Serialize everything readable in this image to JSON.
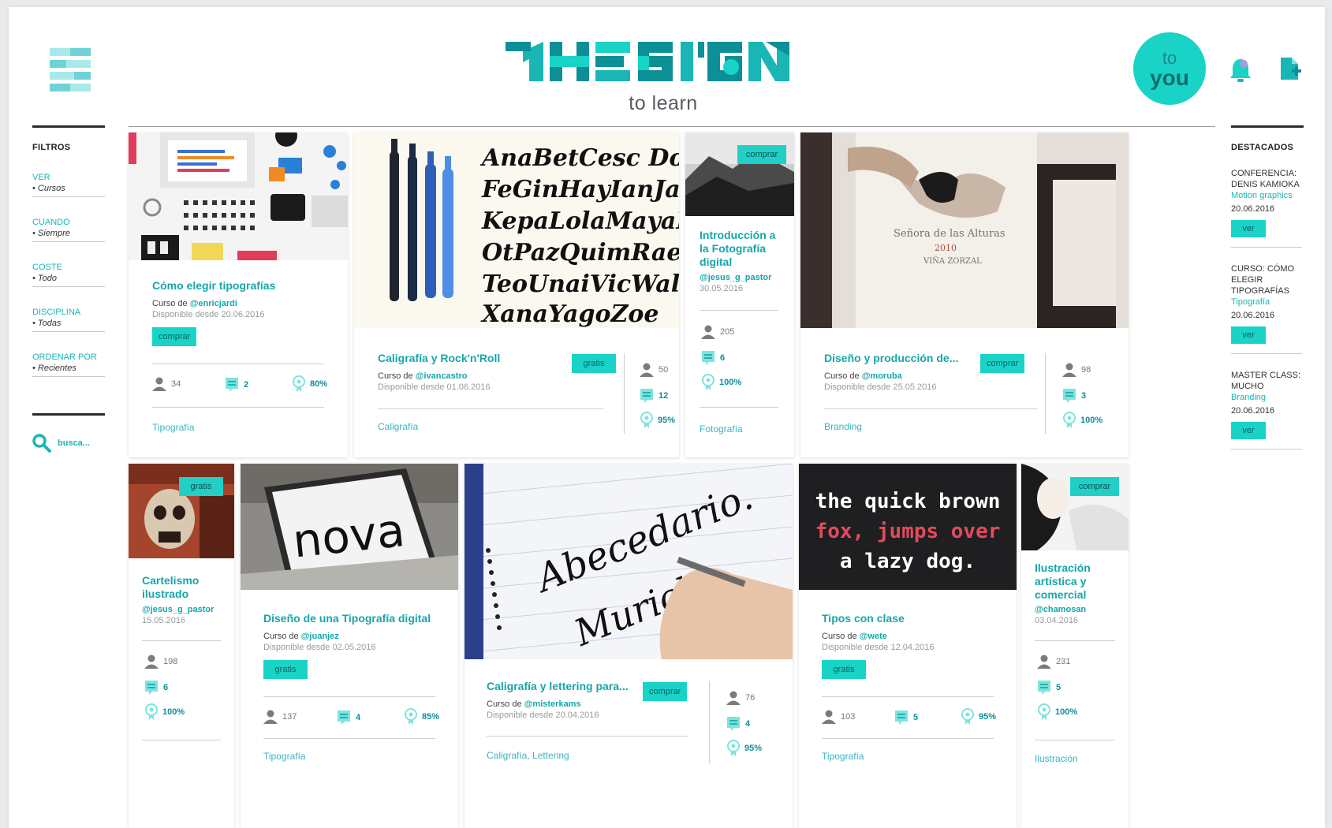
{
  "header": {
    "logo_sub": "to learn",
    "to_you_line1": "to",
    "to_you_line2": "you"
  },
  "sidebar_left": {
    "title": "FILTROS",
    "filters": [
      {
        "key": "VER",
        "value": "• Cursos"
      },
      {
        "key": "CUANDO",
        "value": "• Siempre"
      },
      {
        "key": "COSTE",
        "value": "• Todo"
      },
      {
        "key": "DISCIPLINA",
        "value": "• Todas"
      },
      {
        "key": "ORDENAR POR",
        "value": "• Recientes"
      }
    ],
    "search_label": "busca..."
  },
  "sidebar_right": {
    "title": "DESTACADOS",
    "items": [
      {
        "title": "CONFERENCIA: DENIS KAMIOKA",
        "category": "Motion graphics",
        "date": "20.06.2016",
        "button": "ver"
      },
      {
        "title": "CURSO: CÓMO ELEGIR TIPOGRAFÍAS",
        "category": "Tipografía",
        "date": "20.06.2016",
        "button": "ver"
      },
      {
        "title": "MASTER CLASS: MUCHO",
        "category": "Branding",
        "date": "20.06.2016",
        "button": "ver"
      }
    ]
  },
  "courses": [
    {
      "title": "Cómo elegir tipografías",
      "prefix": "Curso de ",
      "author": "@enricjardi",
      "date": "Disponible desde 20.06.2016",
      "badge": "comprar",
      "students": "34",
      "lessons": "2",
      "rating": "80%",
      "tag": "Tipografía"
    },
    {
      "title": "Caligrafía y Rock'n'Roll",
      "prefix": "Curso de ",
      "author": "@ivancastro",
      "date": "Disponible desde 01.06.2016",
      "badge": "gratis",
      "students": "50",
      "lessons": "12",
      "rating": "95%",
      "tag": "Caligrafía",
      "art_text": [
        "AnaBetCesc DonEv",
        "FeGinHayIanJau",
        "KepaLolaMayaN",
        "OtPazQuimRaeS",
        "TeoUnaiVicWalt",
        "XanaYagoZoe"
      ]
    },
    {
      "title": "Introducción a la Fotografía digital",
      "author": "@jesus_g_pastor",
      "date": "30.05.2016",
      "badge": "comprar",
      "students": "205",
      "lessons": "6",
      "rating": "100%",
      "tag": "Fotografía"
    },
    {
      "title": "Diseño y producción de...",
      "prefix": "Curso de ",
      "author": "@moruba",
      "date": "Disponible desde 25.05.2016",
      "badge": "comprar",
      "students": "98",
      "lessons": "3",
      "rating": "100%",
      "tag": "Branding",
      "art_text": [
        "Señora de las Alturas",
        "2010",
        "VIÑA ZORZAL"
      ]
    },
    {
      "title": "Cartelismo ilustrado",
      "author": "@jesus_g_pastor",
      "date": "15.05.2016",
      "badge": "gratis",
      "students": "198",
      "lessons": "6",
      "rating": "100%"
    },
    {
      "title": "Diseño de una Tipografía digital",
      "prefix": "Curso de ",
      "author": "@juanjez",
      "date": "Disponible desde 02.05.2016",
      "badge": "gratis",
      "students": "137",
      "lessons": "4",
      "rating": "85%",
      "tag": "Tipografía",
      "art_text": [
        "nova"
      ]
    },
    {
      "title": "Caligrafía y lettering para...",
      "prefix": "Curso de ",
      "author": "@misterkams",
      "date": "Disponible desde 20.04.2016",
      "badge": "comprar",
      "students": "76",
      "lessons": "4",
      "rating": "95%",
      "tag": "Caligrafía, Lettering",
      "art_text": [
        "Abecedario.",
        "Muricla"
      ]
    },
    {
      "title": "Tipos con clase",
      "prefix": "Curso de ",
      "author": "@wete",
      "date": "Disponible desde 12.04.2016",
      "badge": "gratis",
      "students": "103",
      "lessons": "5",
      "rating": "95%",
      "tag": "Tipografía",
      "art_text": [
        "the quick brown",
        "fox, jumps over",
        "a lazy dog."
      ]
    },
    {
      "title": "Ilustración artística y comercial",
      "author": "@chamosan",
      "date": "03.04.2016",
      "badge": "comprar",
      "students": "231",
      "lessons": "5",
      "rating": "100%",
      "tag": "Ilustración"
    }
  ],
  "colors": {
    "accent": "#1ad3c7",
    "link": "#16a6a8",
    "dark": "#2b2b2b"
  }
}
